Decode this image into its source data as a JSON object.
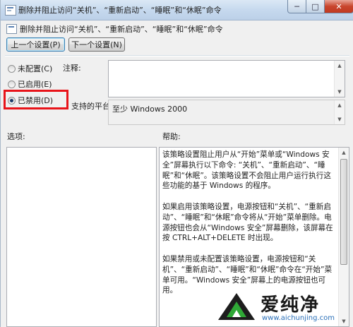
{
  "window": {
    "title": "删除并阻止访问“关机”、“重新启动”、“睡眠”和“休眠”命令",
    "minimize_glyph": "─",
    "maximize_glyph": "□",
    "close_glyph": "✕"
  },
  "policy": {
    "title": "删除并阻止访问“关机”、“重新启动”、“睡眠”和“休眠”命令",
    "prev_button": "上一个设置(P)",
    "next_button": "下一个设置(N)"
  },
  "radios": [
    {
      "label": "未配置(C)",
      "checked": false
    },
    {
      "label": "已启用(E)",
      "checked": false
    },
    {
      "label": "已禁用(D)",
      "checked": true
    }
  ],
  "comment_label": "注释:",
  "comment_value": "",
  "platform_label": "支持的平台:",
  "platform_value": "至少 Windows 2000",
  "options_label": "选项:",
  "help_label": "帮助:",
  "help_paragraphs": [
    "该策略设置阻止用户从“开始”菜单或“Windows 安全”屏幕执行以下命令: “关机”、“重新启动”、“睡眠”和“休眠”。该策略设置不会阻止用户运行执行这些功能的基于 Windows 的程序。",
    "如果启用该策略设置，电源按钮和“关机”、“重新启动”、“睡眠”和“休眠”命令将从“开始”菜单删除。电源按钮也会从“Windows 安全”屏幕删除，该屏幕在按 CTRL+ALT+DELETE 时出现。",
    "如果禁用或未配置该策略设置，电源按钮和“关机”、“重新启动”、“睡眠”和“休眠”命令在“开始”菜单可用。“Windows 安全”屏幕上的电源按钮也可用。"
  ],
  "watermark": {
    "text": "爱纯净",
    "url": "www.aichunjing.com"
  },
  "colors": {
    "highlight_box": "#e8141a",
    "titlebar": "#c6d9ee",
    "window_bg": "#f0f0f0"
  }
}
